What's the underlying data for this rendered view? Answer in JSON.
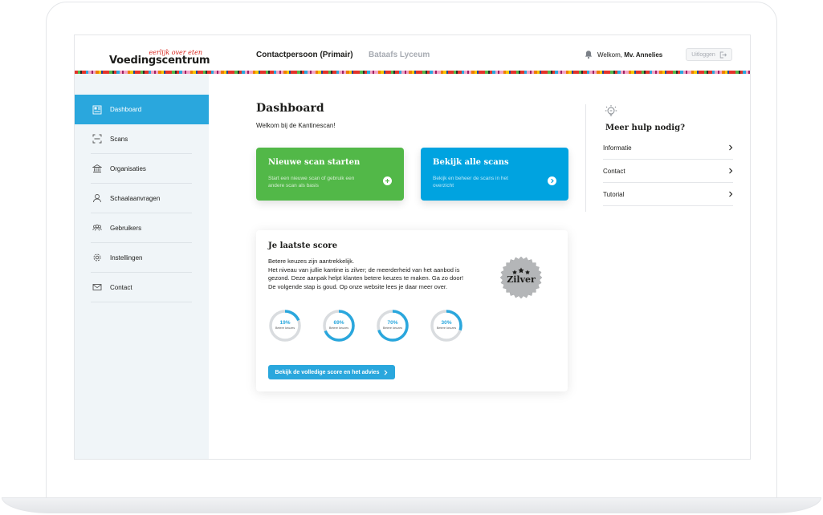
{
  "brand": {
    "tagline": "eerlijk over eten",
    "name": "Voedingscentrum",
    "accent": "#d6241c"
  },
  "header": {
    "org_primary": "Contactpersoon (Primair)",
    "org_secondary": "Bataafs Lyceum",
    "welcome_prefix": "Welkom,",
    "welcome_user": "Mv. Annelies",
    "logout_label": "Uitloggen"
  },
  "sidebar": {
    "items": [
      {
        "label": "Dashboard",
        "icon": "dashboard-icon",
        "active": true
      },
      {
        "label": "Scans",
        "icon": "scan-icon"
      },
      {
        "label": "Organisaties",
        "icon": "building-icon"
      },
      {
        "label": "Schaalaanvragen",
        "icon": "user-badge-icon"
      },
      {
        "label": "Gebruikers",
        "icon": "users-icon"
      },
      {
        "label": "Instellingen",
        "icon": "gear-icon"
      },
      {
        "label": "Contact",
        "icon": "mail-icon"
      }
    ]
  },
  "main": {
    "title": "Dashboard",
    "subtitle": "Welkom bij de Kantinescan!",
    "cards": [
      {
        "title": "Nieuwe scan starten",
        "desc": "Start een nieuwe scan of gebruik een andere scan als basis",
        "icon": "plus-circle-icon",
        "color": "#52b848"
      },
      {
        "title": "Bekijk alle scans",
        "desc": "Bekijk en beheer de scans in het overzicht",
        "icon": "chevron-circle-icon",
        "color": "#00a3e0"
      }
    ]
  },
  "help": {
    "title": "Meer hulp nodig?",
    "icon": "lightbulb-icon",
    "links": [
      "Informatie",
      "Contact",
      "Tutorial"
    ]
  },
  "score": {
    "title": "Je laatste score",
    "lines": [
      "Betere keuzes zijn aantrekkelijk.",
      "Het niveau van jullie kantine is zilver; de meerderheid van het aanbod is gezond. Deze aanpak helpt klanten betere keuzes te maken. Ga zo door! De volgende stap is goud. Op onze website lees je daar meer over."
    ],
    "badge_label": "Zilver",
    "rings": [
      {
        "percent": 19,
        "label": "19%",
        "sub": "Betere keuzes"
      },
      {
        "percent": 69,
        "label": "69%",
        "sub": "Betere keuzes"
      },
      {
        "percent": 70,
        "label": "70%",
        "sub": "Betere keuzes"
      },
      {
        "percent": 30,
        "label": "30%",
        "sub": "Betere keuzes"
      }
    ],
    "ring_color": "#2aa7dd",
    "button_label": "Bekijk de volledige score en het advies"
  }
}
